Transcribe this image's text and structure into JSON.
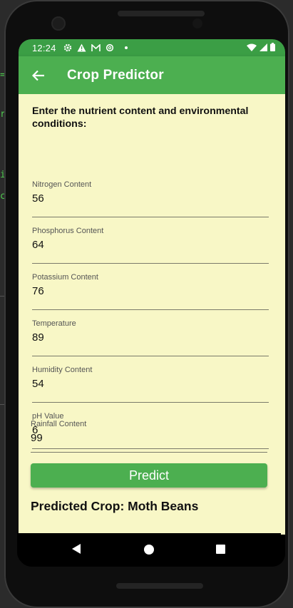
{
  "status_bar": {
    "time": "12:24",
    "icons_left": [
      "gear-icon",
      "warning-icon",
      "gmail-icon",
      "settings-icon",
      "dot-icon"
    ],
    "icons_right": [
      "wifi-icon",
      "signal-icon",
      "battery-icon"
    ]
  },
  "app_bar": {
    "title": "Crop Predictor",
    "back_icon": "arrow-back-icon",
    "color": "#4caf50"
  },
  "form": {
    "intro": "Enter the nutrient content and environmental conditions:",
    "fields": [
      {
        "label": "Nitrogen Content",
        "value": "56"
      },
      {
        "label": "Phosphorus Content",
        "value": "64"
      },
      {
        "label": "Potassium Content",
        "value": "76"
      },
      {
        "label": "Temperature",
        "value": "89"
      },
      {
        "label": "Humidity Content",
        "value": "54"
      },
      {
        "label": "pH Value",
        "value": "6"
      },
      {
        "label": "Rainfall Content",
        "value": "99"
      }
    ],
    "background": "#f8f7c6"
  },
  "predict_button": {
    "label": "Predict"
  },
  "result": {
    "text": "Predicted Crop: Moth Beans"
  },
  "nav_bar": {
    "icons": [
      "back-triangle-icon",
      "home-circle-icon",
      "recents-square-icon"
    ]
  }
}
